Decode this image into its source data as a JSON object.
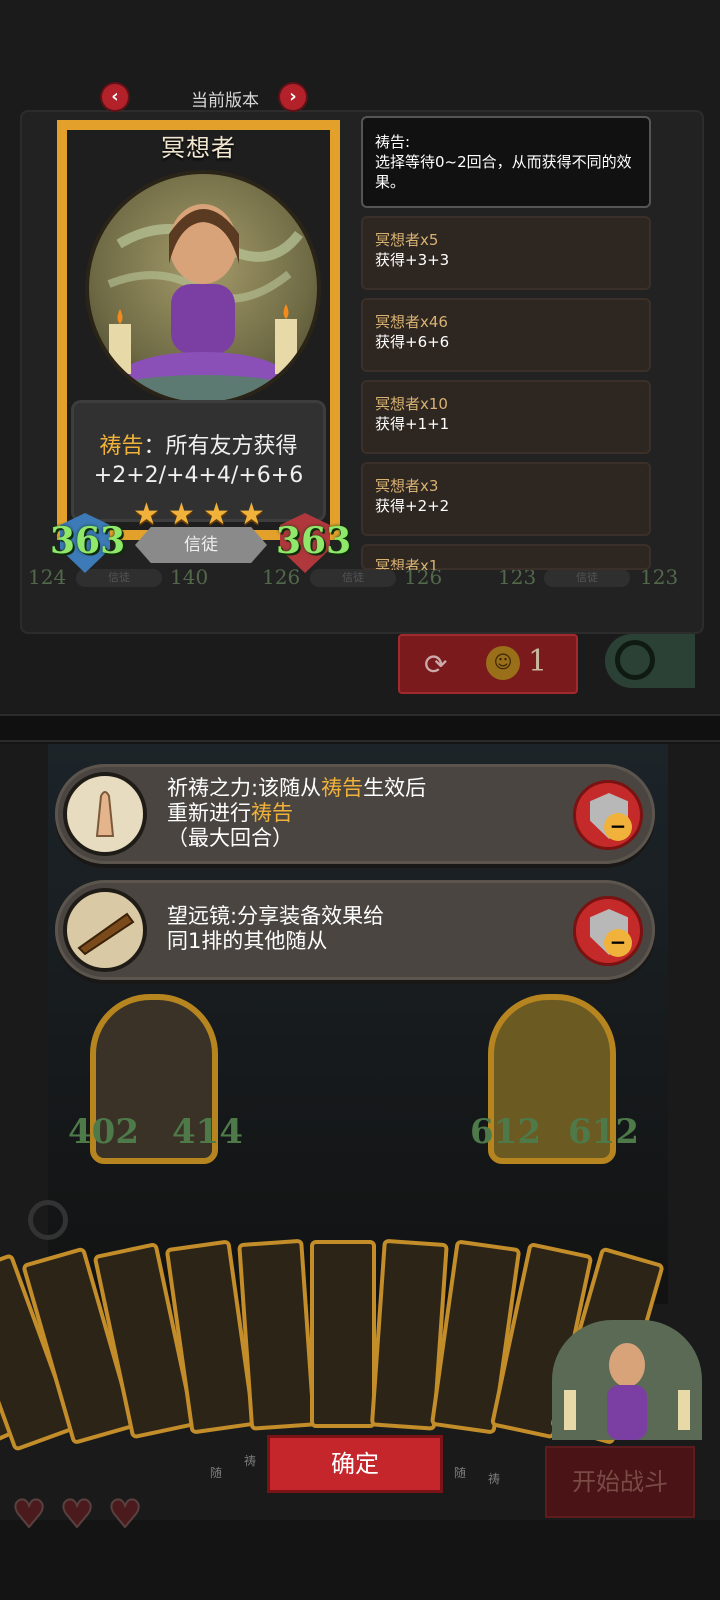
{
  "version_nav": {
    "label": "当前版本",
    "prev": "‹",
    "next": "›"
  },
  "card": {
    "name": "冥想者",
    "stars": [
      "★",
      "★",
      "★",
      "★"
    ],
    "ability_keyword": "祷告",
    "ability_rest": "：所有友方获得",
    "ability_line2": "+2+2/+4+4/+6+6",
    "attack": "363",
    "health": "363",
    "type": "信徒"
  },
  "description": {
    "title": "祷告:",
    "text": "选择等待0~2回合，从而获得不同的效果。"
  },
  "variants": [
    {
      "name": "冥想者x5",
      "effect": "获得+3+3"
    },
    {
      "name": "冥想者x46",
      "effect": "获得+6+6"
    },
    {
      "name": "冥想者x10",
      "effect": "获得+1+1"
    },
    {
      "name": "冥想者x3",
      "effect": "获得+2+2"
    },
    {
      "name": "冥想者x1",
      "effect": ""
    }
  ],
  "background_cards": [
    {
      "atk": "124",
      "hp": "140",
      "type": "信徒"
    },
    {
      "atk": "126",
      "hp": "126",
      "type": "信徒"
    },
    {
      "atk": "123",
      "hp": "123",
      "type": "信徒"
    }
  ],
  "reroll": {
    "icon": "refresh-icon",
    "coin_icon": "coin-icon",
    "cost": "1"
  },
  "equipment": [
    {
      "name_prefix": "祈祷之力:该随从",
      "kw1": "祷告",
      "mid": "生效后",
      "line2_prefix": "重新进行",
      "kw2": "祷告",
      "line3": "（最大回合）",
      "icon": "praying-hands-icon"
    },
    {
      "line1": "望远镜:分享装备效果给",
      "line2": "同1排的其他随从",
      "icon": "telescope-icon"
    }
  ],
  "board_minions": [
    {
      "atk": "402",
      "hp": "414"
    },
    {
      "atk": "612",
      "hp": "612"
    }
  ],
  "buttons": {
    "confirm": "确定",
    "start_battle": "开始战斗"
  },
  "hand_small_labels": [
    "随",
    "祷",
    "随",
    "祷"
  ],
  "colors": {
    "accent_gold": "#f0b23b",
    "stat_green": "#8fe86a",
    "button_red": "#c4262b"
  }
}
